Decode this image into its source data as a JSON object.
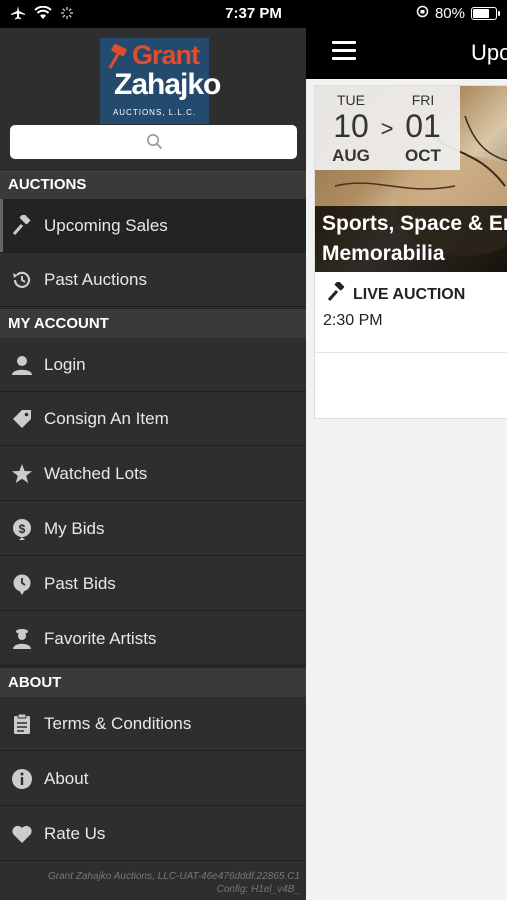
{
  "status": {
    "time": "7:37 PM",
    "battery": "80%",
    "battery_level": 0.8
  },
  "logo": {
    "line1": "Grant",
    "line2": "Zahajko",
    "line3": "AUCTIONS, L.L.C."
  },
  "search": {
    "placeholder": ""
  },
  "menu": {
    "auctions_header": "AUCTIONS",
    "upcoming": "Upcoming Sales",
    "past_auctions": "Past Auctions",
    "account_header": "MY ACCOUNT",
    "login": "Login",
    "consign": "Consign An Item",
    "watched": "Watched Lots",
    "my_bids": "My Bids",
    "past_bids": "Past Bids",
    "favorite_artists": "Favorite Artists",
    "about_header": "ABOUT",
    "terms": "Terms & Conditions",
    "about": "About",
    "rate": "Rate Us"
  },
  "footer": {
    "line1": "Grant Zahajko Auctions, LLC-UAT-46e476dddf.22865.C1",
    "line2": "Config: H1el_v4B_"
  },
  "main": {
    "title": "Upcoming Sales",
    "card": {
      "start_dow": "TUE",
      "start_day": "10",
      "start_month": "AUG",
      "arrow": ">",
      "end_dow": "FRI",
      "end_day": "01",
      "end_month": "OCT",
      "title_line1": "Sports, Space & Entertainment",
      "title_line2": "Memorabilia",
      "type": "LIVE AUCTION",
      "time": "2:30 PM"
    }
  },
  "colors": {
    "drawer_bg": "#2e2e2e",
    "section_bg": "#3a3a3a",
    "logo_blue": "#244a6e",
    "logo_orange": "#e04d2c"
  }
}
